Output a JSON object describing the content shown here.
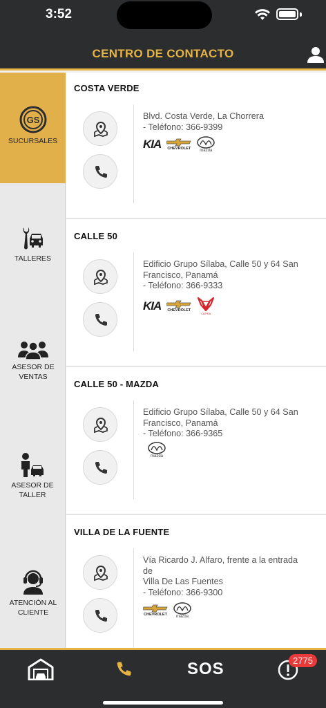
{
  "status": {
    "time": "3:52"
  },
  "header": {
    "title": "CENTRO DE CONTACTO",
    "profile_icon": "user-icon"
  },
  "sidebar": {
    "items": [
      {
        "label": "SUCURSALES",
        "icon": "gs-logo-icon",
        "active": true
      },
      {
        "label": "TALLERES",
        "icon": "wrench-car-icon",
        "active": false
      },
      {
        "label": "ASESOR DE VENTAS",
        "icon": "people-group-icon",
        "active": false
      },
      {
        "label": "ASESOR DE TALLER",
        "icon": "mechanic-icon",
        "active": false
      },
      {
        "label": "ATENCIÓN AL CLIENTE",
        "icon": "headset-icon",
        "active": false
      }
    ]
  },
  "locations": [
    {
      "name": "COSTA VERDE",
      "address_lines": [
        "Blvd. Costa Verde, La Chorrera",
        "- Teléfono: 366-9399"
      ],
      "brands": [
        "KIA",
        "CHEVROLET",
        "mazda"
      ]
    },
    {
      "name": "CALLE 50",
      "address_lines": [
        "Edificio Grupo Sílaba, Calle 50 y 64 San",
        "Francisco, Panamá",
        "- Teléfono: 366-9333"
      ],
      "brands": [
        "KIA",
        "CHEVROLET",
        "CUPRA"
      ]
    },
    {
      "name": "CALLE 50 - MAZDA",
      "address_lines": [
        "Edificio Grupo Sílaba, Calle 50 y 64 San",
        "Francisco, Panamá",
        "- Teléfono: 366-9365"
      ],
      "brands": [
        "mazda"
      ]
    },
    {
      "name": "VILLA DE LA FUENTE",
      "address_lines": [
        "Vía Ricardo J. Alfaro, frente a la entrada",
        "de",
        "Villa De Las Fuentes",
        "- Teléfono: 366-9300"
      ],
      "brands": [
        "CHEVROLET",
        "mazda"
      ]
    }
  ],
  "bottom_bar": {
    "home_icon": "garage-home-icon",
    "phone_icon": "phone-icon",
    "sos_label": "SOS",
    "alert_icon": "alert-icon",
    "badge_count": "2775"
  },
  "colors": {
    "dark": "#2b2d2e",
    "accent": "#e6b445",
    "badge": "#e83a3a"
  }
}
